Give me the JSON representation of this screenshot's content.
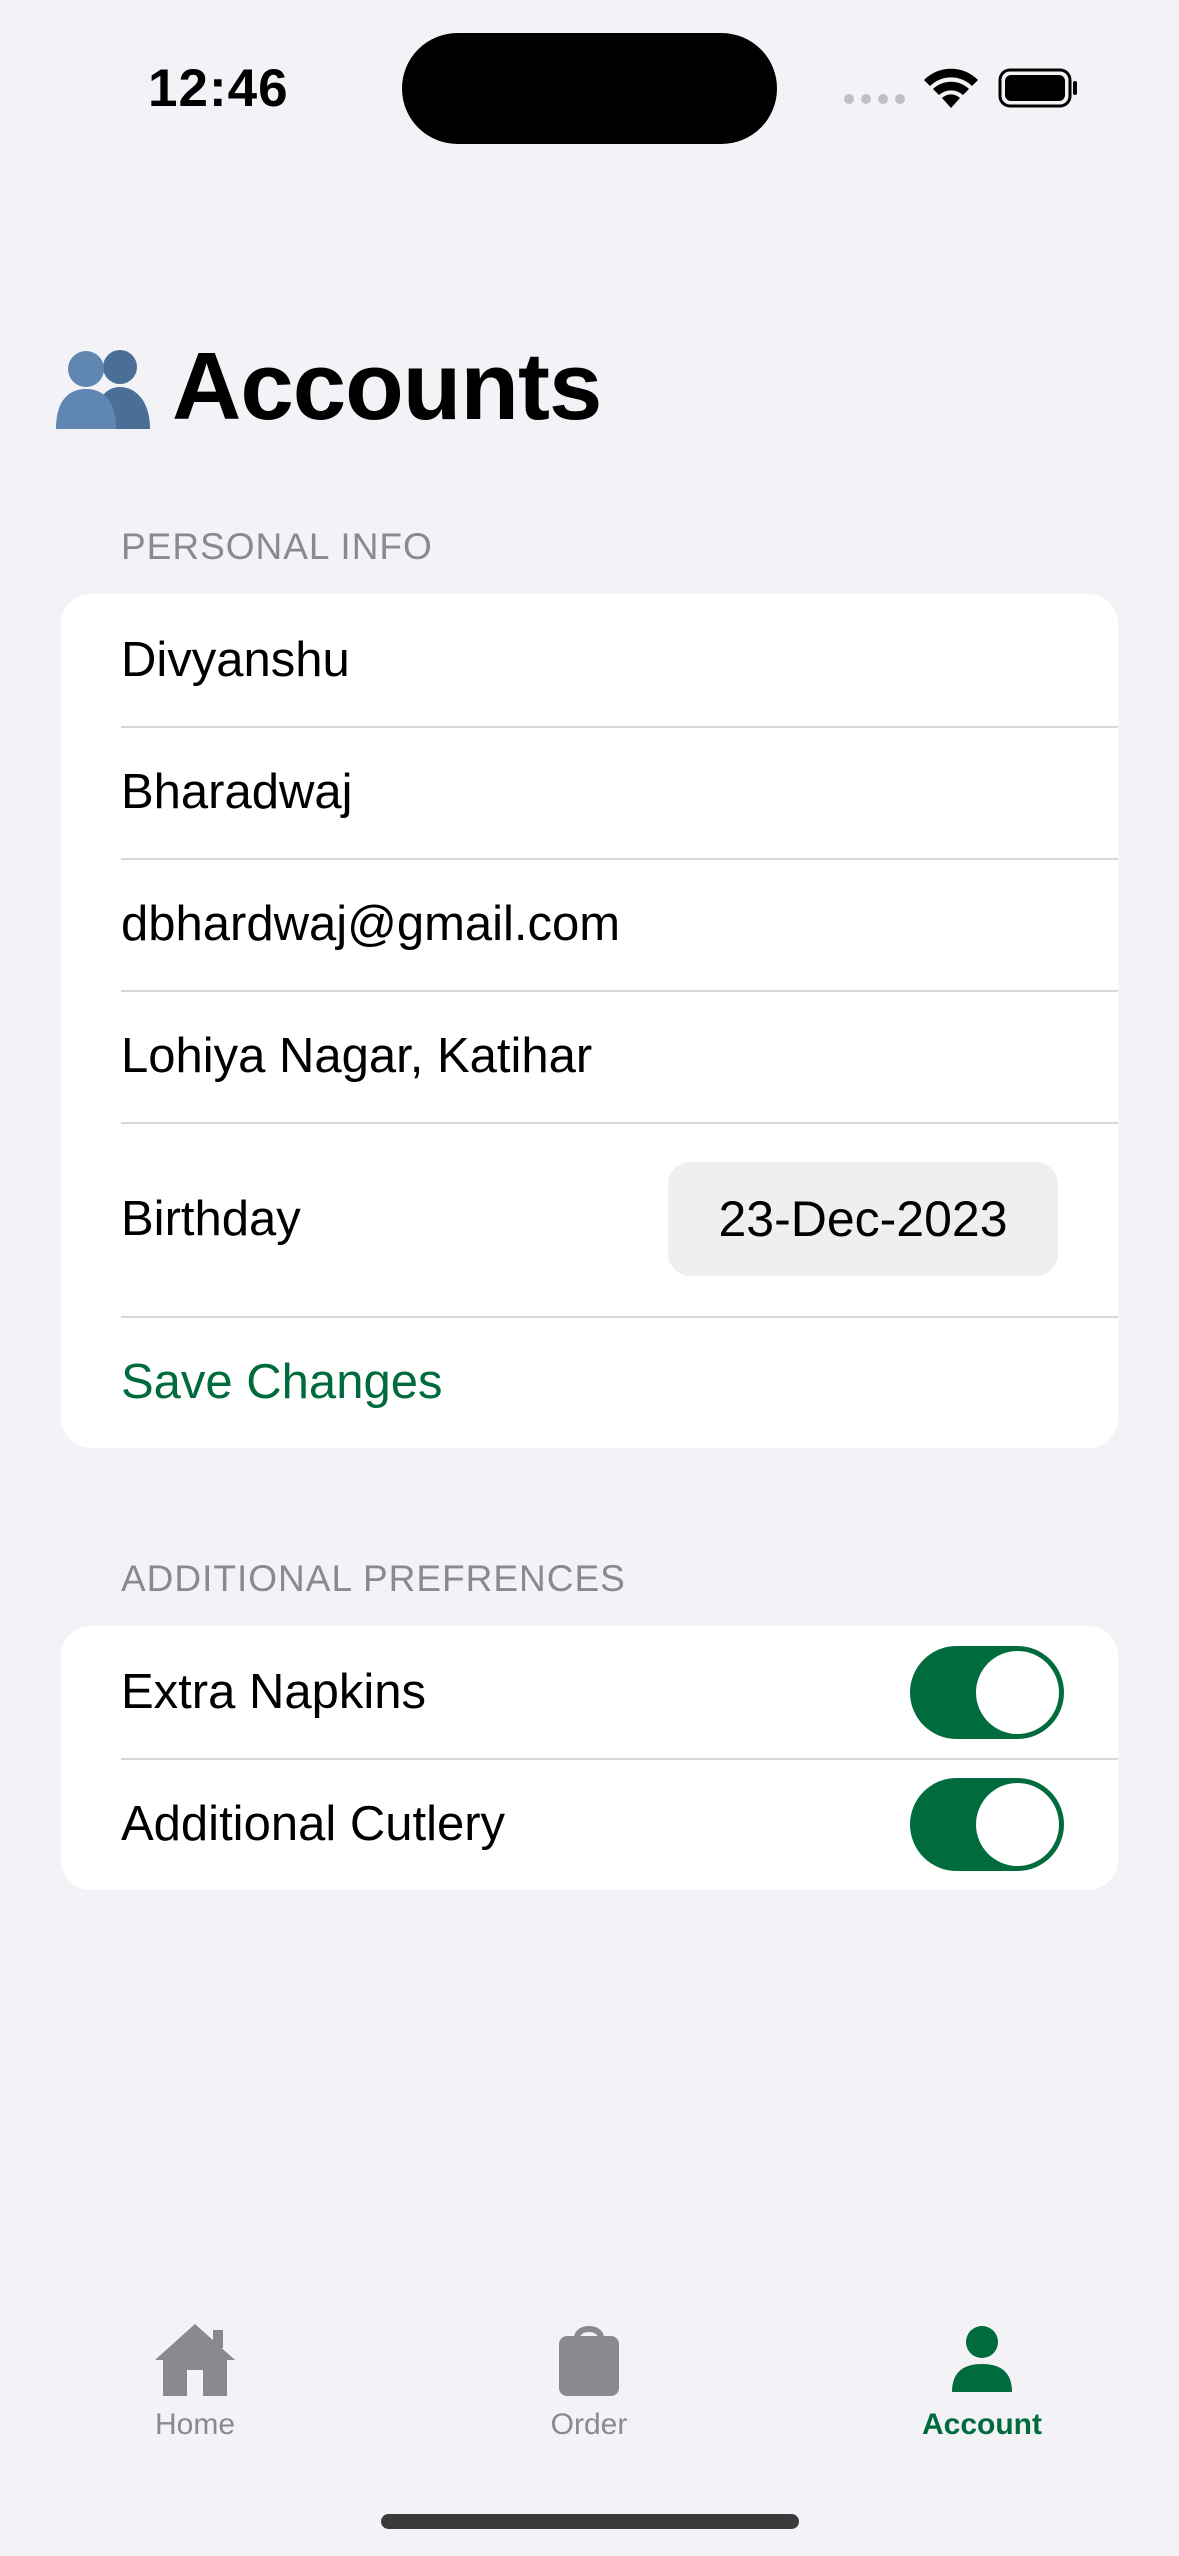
{
  "status_bar": {
    "time": "12:46"
  },
  "page": {
    "title": "Accounts",
    "title_icon": "two-people-icon"
  },
  "personal_info": {
    "header": "PERSONAL INFO",
    "first_name": "Divyanshu",
    "last_name": "Bharadwaj",
    "email": "dbhardwaj@gmail.com",
    "address": "Lohiya Nagar, Katihar",
    "birthday_label": "Birthday",
    "birthday_value": "23-Dec-2023",
    "save_label": "Save Changes"
  },
  "preferences": {
    "header": "ADDITIONAL PREFRENCES",
    "items": [
      {
        "label": "Extra Napkins",
        "on": true
      },
      {
        "label": "Additional Cutlery",
        "on": true
      }
    ]
  },
  "tabs": [
    {
      "label": "Home",
      "icon": "house-icon",
      "active": false
    },
    {
      "label": "Order",
      "icon": "bag-icon",
      "active": false
    },
    {
      "label": "Account",
      "icon": "person-icon",
      "active": true
    }
  ],
  "colors": {
    "accent": "#006b3c",
    "background": "#f2f2f7"
  }
}
